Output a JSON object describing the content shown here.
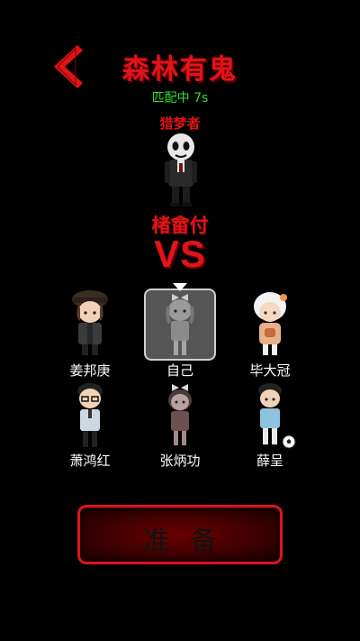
{
  "header": {
    "title": "森林有鬼",
    "status": "匹配中 7s"
  },
  "hunter": {
    "role": "猎梦者",
    "name": "楮畲付",
    "avatar_icon": "masked-ghost-character-icon"
  },
  "versus": "VS",
  "players": [
    {
      "name": "姜邦庚",
      "avatar_icon": "detective-hat-character-icon",
      "selected": false
    },
    {
      "name": "自己",
      "avatar_icon": "bow-girl-character-icon",
      "selected": true
    },
    {
      "name": "毕大冠",
      "avatar_icon": "white-hair-girl-character-icon",
      "selected": false
    },
    {
      "name": "萧鸿红",
      "avatar_icon": "glasses-boy-character-icon",
      "selected": false
    },
    {
      "name": "张炳功",
      "avatar_icon": "bow-girl-character-icon",
      "selected": false
    },
    {
      "name": "薛呈",
      "avatar_icon": "soccer-boy-character-icon",
      "selected": false
    }
  ],
  "ready_button": {
    "label": "准备"
  },
  "colors": {
    "accent_red": "#e0141a",
    "status_green": "#2ee02e",
    "background": "#000000"
  }
}
